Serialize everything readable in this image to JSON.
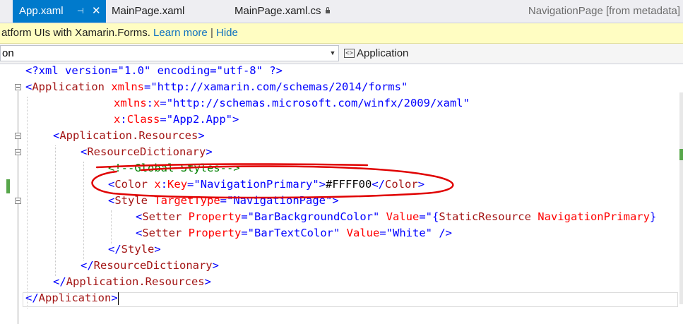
{
  "tabs": [
    {
      "label": "App.xaml",
      "pin": "⊣",
      "close": "✕"
    },
    {
      "label": "MainPage.xaml"
    },
    {
      "label": "MainPage.xaml.cs"
    }
  ],
  "metadata_tab": "NavigationPage [from metadata]",
  "infobar": {
    "message": "atform UIs with Xamarin.Forms.",
    "learn_more": "Learn more",
    "separator": "|",
    "hide": "Hide"
  },
  "navbar": {
    "left_value": "on",
    "right_value": "Application"
  },
  "code": {
    "l1": {
      "a": "<?xml version=\"1.0\" encoding=\"utf-8\" ?>"
    },
    "l2": {
      "a": "<",
      "b": "Application",
      "c": " xmlns",
      "d": "=\"http://xamarin.com/schemas/2014/forms\""
    },
    "l3": {
      "c": "xmlns",
      "p": ":",
      "x": "x",
      "d": "=\"http://schemas.microsoft.com/winfx/2009/xaml\""
    },
    "l4": {
      "c": "x",
      "p": ":",
      "x": "Class",
      "d": "=\"App2.App\"",
      "e": ">"
    },
    "l5": {
      "a": "<",
      "b": "Application.Resources",
      "e": ">"
    },
    "l6": {
      "a": "<",
      "b": "ResourceDictionary",
      "e": ">"
    },
    "l7": {
      "a": "<!--Global Styles-->"
    },
    "l8": {
      "a": "<",
      "b": "Color",
      "c": " x",
      "p": ":",
      "x": "Key",
      "d": "=\"NavigationPrimary\"",
      "e": ">",
      "t": "#FFFF00",
      "f": "</",
      "g": "Color",
      "h": ">"
    },
    "l9": {
      "a": "<",
      "b": "Style",
      "c": " TargetType",
      "d": "=\"NavigationPage\"",
      "e": ">"
    },
    "l10": {
      "a": "<",
      "b": "Setter",
      "c": " Property",
      "d": "=\"BarBackgroundColor\"",
      "c2": " Value",
      "d2": "=\"{",
      "e2": "StaticResource",
      "f2": " NavigationPrimary",
      "g2": "}"
    },
    "l11": {
      "a": "<",
      "b": "Setter",
      "c": " Property",
      "d": "=\"BarTextColor\"",
      "c2": " Value",
      "d2": "=\"White\"",
      "e": " />"
    },
    "l12": {
      "a": "</",
      "b": "Style",
      "e": ">"
    },
    "l13": {
      "a": "</",
      "b": "ResourceDictionary",
      "e": ">"
    },
    "l14": {
      "a": "</",
      "b": "Application.Resources",
      "e": ">"
    },
    "l15": {
      "a": "</",
      "b": "Application",
      "e": ">"
    }
  },
  "colors": {
    "accent": "#007acc",
    "infobar_bg": "#fffdc2",
    "annotation": "#e00000",
    "change_marker": "#57a64a"
  }
}
